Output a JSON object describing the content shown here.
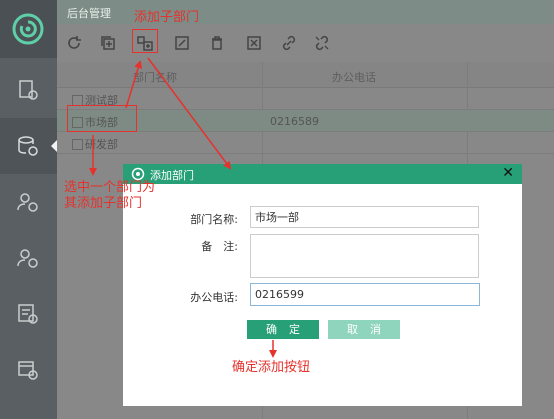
{
  "app": {
    "title": "后台管理"
  },
  "rail": [
    {
      "icon": "report-icon"
    },
    {
      "icon": "database-icon"
    },
    {
      "icon": "user-settings-icon"
    },
    {
      "icon": "user-group-icon"
    },
    {
      "icon": "document-settings-icon"
    },
    {
      "icon": "window-settings-icon"
    }
  ],
  "toolbar": [
    {
      "icon": "refresh-icon"
    },
    {
      "icon": "add-icon"
    },
    {
      "icon": "add-child-icon"
    },
    {
      "icon": "edit-icon"
    },
    {
      "icon": "delete-icon"
    },
    {
      "icon": "disable-icon"
    },
    {
      "icon": "link-icon"
    },
    {
      "icon": "unlink-icon"
    }
  ],
  "grid": {
    "columns": [
      "部门名称",
      "办公电话"
    ],
    "rows": [
      {
        "name": "测试部",
        "phone": ""
      },
      {
        "name": "市场部",
        "phone": "0216589",
        "selected": true
      },
      {
        "name": "研发部",
        "phone": ""
      }
    ]
  },
  "dialog": {
    "title": "添加部门",
    "fields": {
      "name_label": "部门名称:",
      "name_value": "市场一部",
      "note_label": "备　注:",
      "note_value": "",
      "phone_label": "办公电话:",
      "phone_value": "0216599"
    },
    "ok_label": "确定",
    "cancel_label": "取消"
  },
  "annotations": {
    "add_child": "添加子部门",
    "select": "选中一个部门为其添加子部门",
    "confirm": "确定添加按钮"
  },
  "colors": {
    "accent": "#27a078",
    "annotation": "#e5322d"
  }
}
